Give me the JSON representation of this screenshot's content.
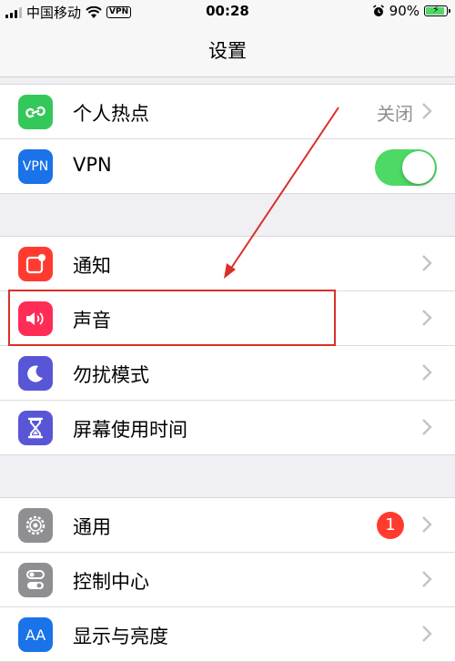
{
  "status_bar": {
    "carrier": "中国移动",
    "vpn_label": "VPN",
    "time": "00:28",
    "battery_percent": "90%",
    "battery_level": 0.9
  },
  "nav": {
    "title": "设置"
  },
  "groups": {
    "network": {
      "hotspot": {
        "label": "个人热点",
        "value": "关闭",
        "icon": "hotspot-icon",
        "color": "#34c759"
      },
      "vpn": {
        "label": "VPN",
        "icon_text": "VPN",
        "icon": "vpn-icon",
        "color": "#1a73e8",
        "toggle_on": true
      }
    },
    "notifications": {
      "notifications": {
        "label": "通知",
        "icon": "notifications-icon",
        "color": "#ff3b30"
      },
      "sounds": {
        "label": "声音",
        "icon": "sound-icon",
        "color": "#ff2d55"
      },
      "dnd": {
        "label": "勿扰模式",
        "icon": "moon-icon",
        "color": "#5856d6"
      },
      "screen_time": {
        "label": "屏幕使用时间",
        "icon": "hourglass-icon",
        "color": "#5856d6"
      }
    },
    "general": {
      "general": {
        "label": "通用",
        "badge": "1",
        "icon": "gear-icon",
        "color": "#8e8e93"
      },
      "control_center": {
        "label": "控制中心",
        "icon": "switches-icon",
        "color": "#8e8e93"
      },
      "display": {
        "label": "显示与亮度",
        "icon_text": "AA",
        "icon": "display-icon",
        "color": "#1a73e8"
      }
    }
  },
  "annotation": {
    "highlight_color": "#d9302a"
  }
}
